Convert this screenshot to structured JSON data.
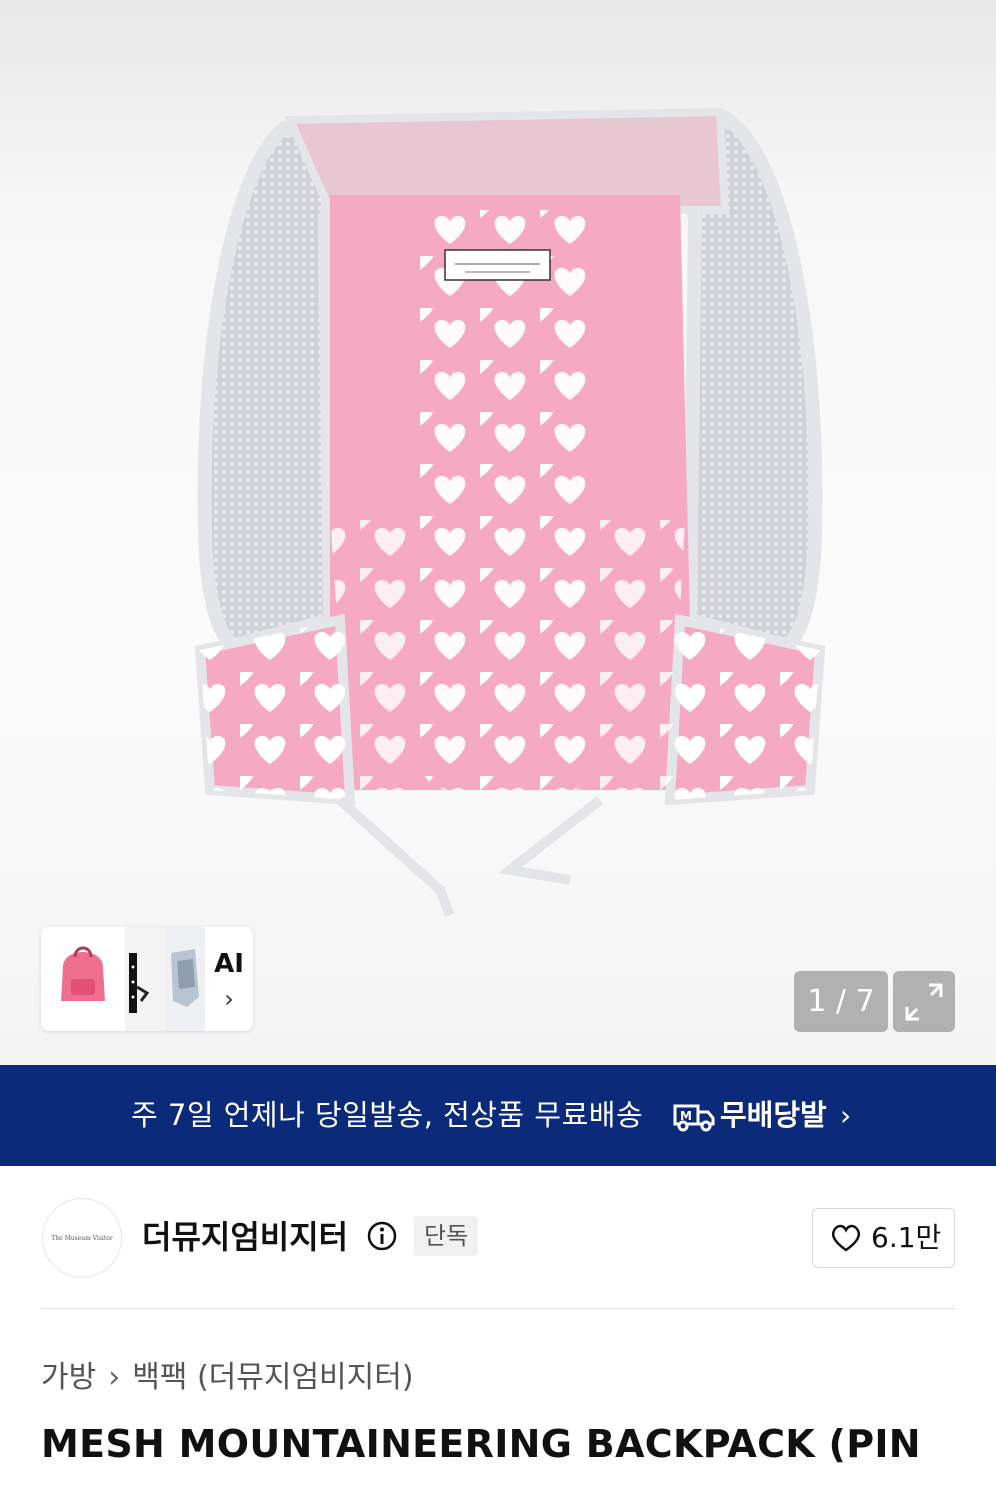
{
  "gallery": {
    "counter": "1 / 7",
    "ai_label": "AI",
    "ai_chevron": "›",
    "thumbnails": [
      "pink-backpack-thumb",
      "dotted-bag-thumb",
      "blue-vest-thumb"
    ],
    "icons": {
      "expand": "expand-icon"
    }
  },
  "banner": {
    "text": "주 7일 언제나 당일발송, 전상품 무료배송",
    "brand": "무배당발",
    "chevron": "›",
    "badge_icon": "delivery-truck-icon",
    "background": "#0b2a79"
  },
  "store": {
    "logo_text": "The Museum Visitor",
    "name": "더뮤지엄비지터",
    "badge": "단독",
    "likes": "6.1만"
  },
  "breadcrumb": {
    "category": "가방",
    "separator": "›",
    "subcategory": "백팩 (더뮤지엄비지터)"
  },
  "product": {
    "title": "MESH MOUNTAINEERING BACKPACK (PIN",
    "label_text": "The Museum Visitor"
  },
  "colors": {
    "accent_pink": "#f6a9c3",
    "mesh_grey": "#d9dade"
  }
}
